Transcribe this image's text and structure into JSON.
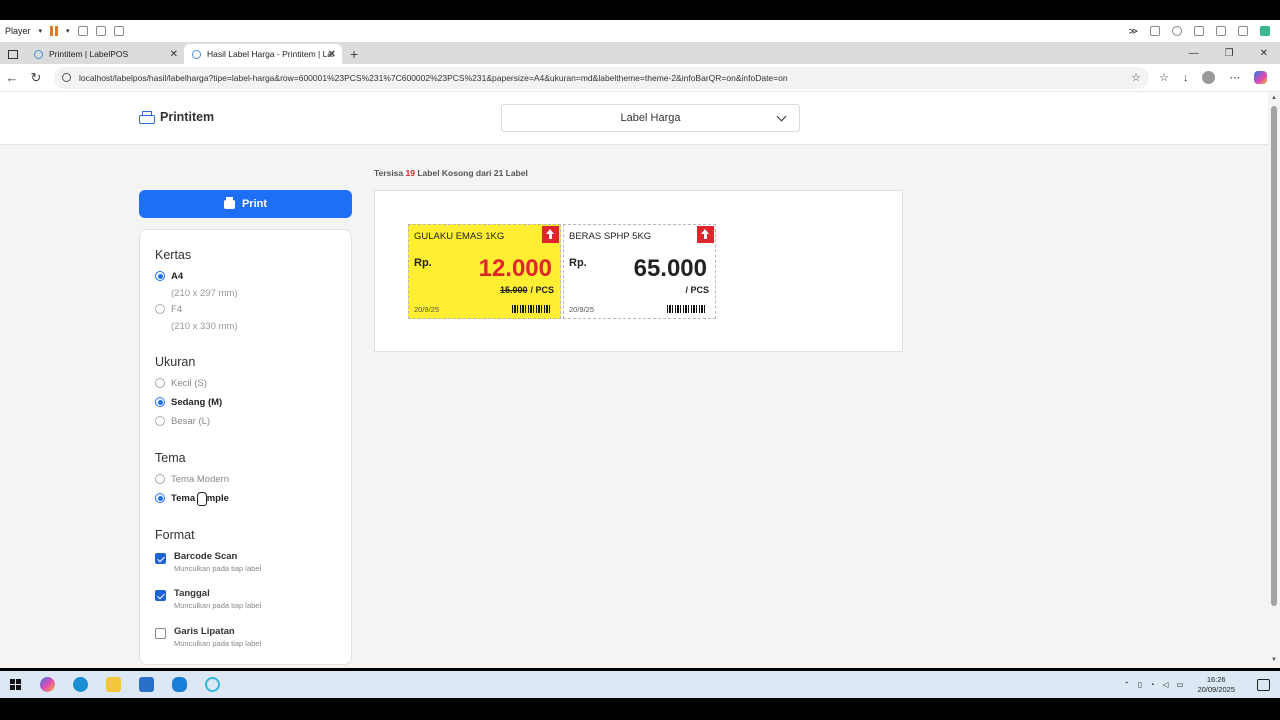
{
  "player": {
    "label": "Player"
  },
  "browser": {
    "tabs": [
      {
        "title": "Printitem | LabelPOS"
      },
      {
        "title": "Hasil Label Harga - Printitem | Lal"
      }
    ],
    "url": "localhost/labelpos/hasil/labelharga?tipe=label-harga&row=600001%23PCS%231%7C600002%23PCS%231&papersize=A4&ukuran=md&labeltheme=theme-2&infoBarQR=on&infoDate=on"
  },
  "header": {
    "brand": "Printitem",
    "select_value": "Label Harga"
  },
  "sidebar": {
    "print_label": "Print",
    "kertas": {
      "title": "Kertas",
      "options": [
        {
          "label": "A4",
          "sub": "(210 x 297 mm)",
          "selected": true
        },
        {
          "label": "F4",
          "sub": "(210 x 330 mm)",
          "selected": false
        }
      ]
    },
    "ukuran": {
      "title": "Ukuran",
      "options": [
        {
          "label": "Kecil (S)",
          "selected": false
        },
        {
          "label": "Sedang (M)",
          "selected": true
        },
        {
          "label": "Besar (L)",
          "selected": false
        }
      ]
    },
    "tema": {
      "title": "Tema",
      "options": [
        {
          "label": "Tema Modern",
          "selected": false
        },
        {
          "label": "Tema Simple",
          "selected": true
        }
      ]
    },
    "format": {
      "title": "Format",
      "items": [
        {
          "label": "Barcode Scan",
          "sub": "Munculkan pada tiap label",
          "checked": true
        },
        {
          "label": "Tanggal",
          "sub": "Munculkan pada tiap label",
          "checked": true
        },
        {
          "label": "Garis Lipatan",
          "sub": "Munculkan pada tiap label",
          "checked": false
        }
      ]
    }
  },
  "status": {
    "prefix": "Tersisa",
    "count": "19",
    "suffix": "Label Kosong dari 21 Label"
  },
  "labels": [
    {
      "name": "GULAKU EMAS 1KG",
      "currency": "Rp.",
      "price": "12.000",
      "old_price": "15.000",
      "unit": "/ PCS",
      "date": "20/9/25",
      "theme_color": "#ffee32",
      "price_color": "#e0262d"
    },
    {
      "name": "BERAS SPHP 5KG",
      "currency": "Rp.",
      "price": "65.000",
      "old_price": "",
      "unit": "/ PCS",
      "date": "20/9/25",
      "theme_color": "#ffffff",
      "price_color": "#222222"
    }
  ],
  "taskbar": {
    "time": "16:26",
    "date": "20/09/2025"
  },
  "colors": {
    "accent": "#1e6ff5",
    "sale_yellow": "#ffee32",
    "badge_red": "#e0262d"
  }
}
